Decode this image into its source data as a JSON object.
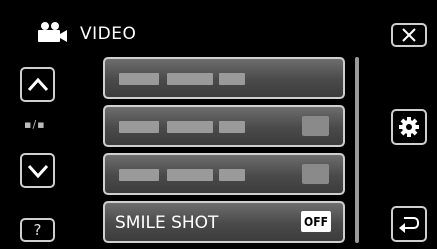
{
  "header": {
    "title": "VIDEO",
    "icon": "video-camera-icon"
  },
  "nav": {
    "up_icon": "chevron-up-icon",
    "down_icon": "chevron-down-icon",
    "page_indicator": "▪/▪",
    "help_label": "?"
  },
  "menu": {
    "items": [
      {
        "label": "",
        "badge": ""
      },
      {
        "label": "",
        "badge": ""
      },
      {
        "label": "",
        "badge": ""
      },
      {
        "label": "SMILE SHOT",
        "badge": "OFF"
      }
    ]
  },
  "side": {
    "close_icon": "close-icon",
    "settings_icon": "gear-icon",
    "back_icon": "return-icon"
  }
}
